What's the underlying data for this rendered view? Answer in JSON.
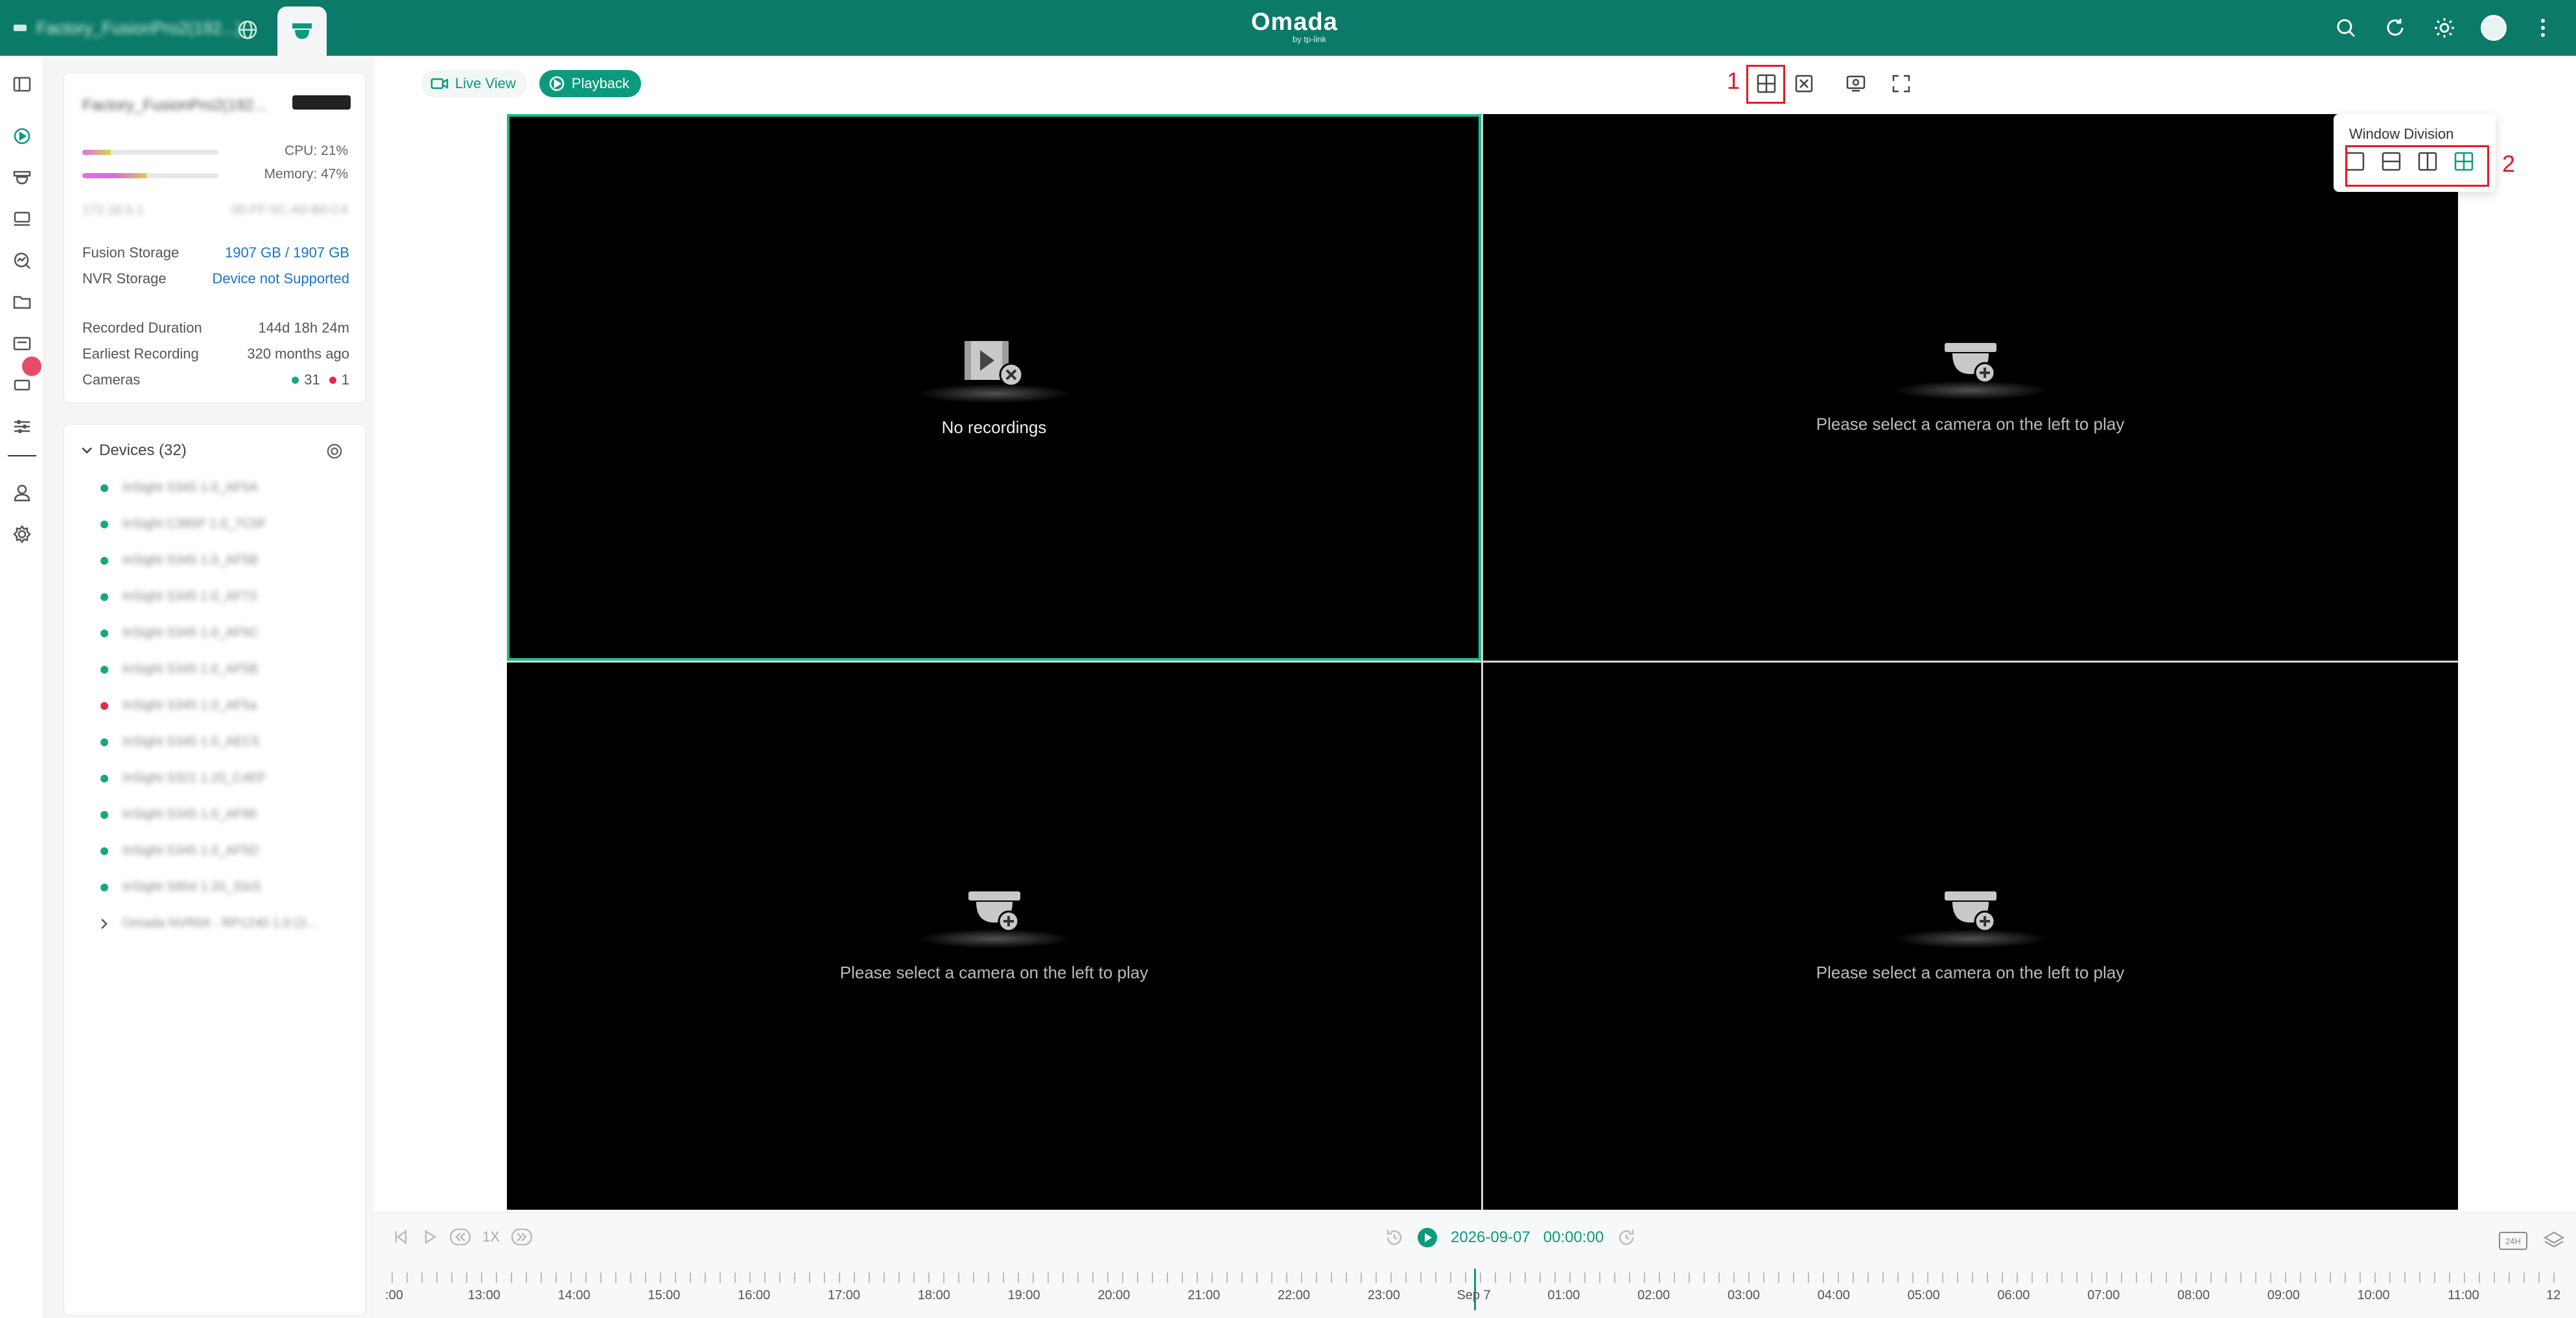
{
  "topbar": {
    "site_name": "Factory_FusionPro2(192...)",
    "brand_name": "Omada",
    "brand_sub": "by tp-link"
  },
  "device_card": {
    "name": "Factory_FusionPro2(192...",
    "cpu": "CPU: 21%",
    "memory": "Memory: 47%",
    "cpu_percent": 21,
    "memory_percent": 47,
    "ip": "172.16.5.1",
    "mac": "00-FF-5C-A0-B0-C4",
    "fusion_storage_label": "Fusion Storage",
    "fusion_storage_value": "1907 GB / 1907 GB",
    "nvr_storage_label": "NVR Storage",
    "nvr_storage_value": "Device not Supported",
    "recorded_duration_label": "Recorded Duration",
    "recorded_duration_value": "144d 18h 24m",
    "earliest_recording_label": "Earliest Recording",
    "earliest_recording_value": "320 months ago",
    "cameras_label": "Cameras",
    "cameras_online": "31",
    "cameras_offline": "1"
  },
  "devices": {
    "header": "Devices (32)",
    "items": [
      {
        "name": "InSight S345 1.0_AF5A",
        "status": "online"
      },
      {
        "name": "InSight C385P 1.0_7C5F",
        "status": "online"
      },
      {
        "name": "InSight S345 1.0_AF5B",
        "status": "online"
      },
      {
        "name": "InSight S345 1.0_AF73",
        "status": "online"
      },
      {
        "name": "InSight S345 1.0_AF5C",
        "status": "online"
      },
      {
        "name": "InSight S345 1.0_AF5B",
        "status": "online"
      },
      {
        "name": "InSight S345 1.0_AF5a",
        "status": "offline"
      },
      {
        "name": "InSight S345 1.0_AEC5",
        "status": "online"
      },
      {
        "name": "InSight S321 1.20_C4EF",
        "status": "online"
      },
      {
        "name": "InSight S345 1.0_AF86",
        "status": "online"
      },
      {
        "name": "InSight S345 1.0_AF5D",
        "status": "online"
      },
      {
        "name": "InSight S654 1.20_33c5",
        "status": "online"
      },
      {
        "name": "Omada NVR04 - RP1240 1.0 (3...",
        "status": "group"
      }
    ]
  },
  "tabs": {
    "live": "Live View",
    "playback": "Playback"
  },
  "annotations": {
    "one": "1",
    "two": "2"
  },
  "popover": {
    "title": "Window Division",
    "selected": "4-split"
  },
  "cells": {
    "no_recordings": "No recordings",
    "select_camera": "Please select a camera on the left to play"
  },
  "playback": {
    "speed": "1X",
    "date": "2026-09-07",
    "time": "00:00:00",
    "format_badge": "24H"
  },
  "timeline": {
    "labels": [
      ":00",
      "13:00",
      "14:00",
      "15:00",
      "16:00",
      "17:00",
      "18:00",
      "19:00",
      "20:00",
      "21:00",
      "22:00",
      "23:00",
      "Sep 7",
      "01:00",
      "02:00",
      "03:00",
      "04:00",
      "05:00",
      "06:00",
      "07:00",
      "08:00",
      "09:00",
      "10:00",
      "11:00",
      "12"
    ]
  },
  "colors": {
    "brand": "#0b7a68",
    "accent": "#0b9a7e",
    "online": "#16a77f",
    "offline": "#e6294b",
    "annotation": "#e21b23"
  }
}
